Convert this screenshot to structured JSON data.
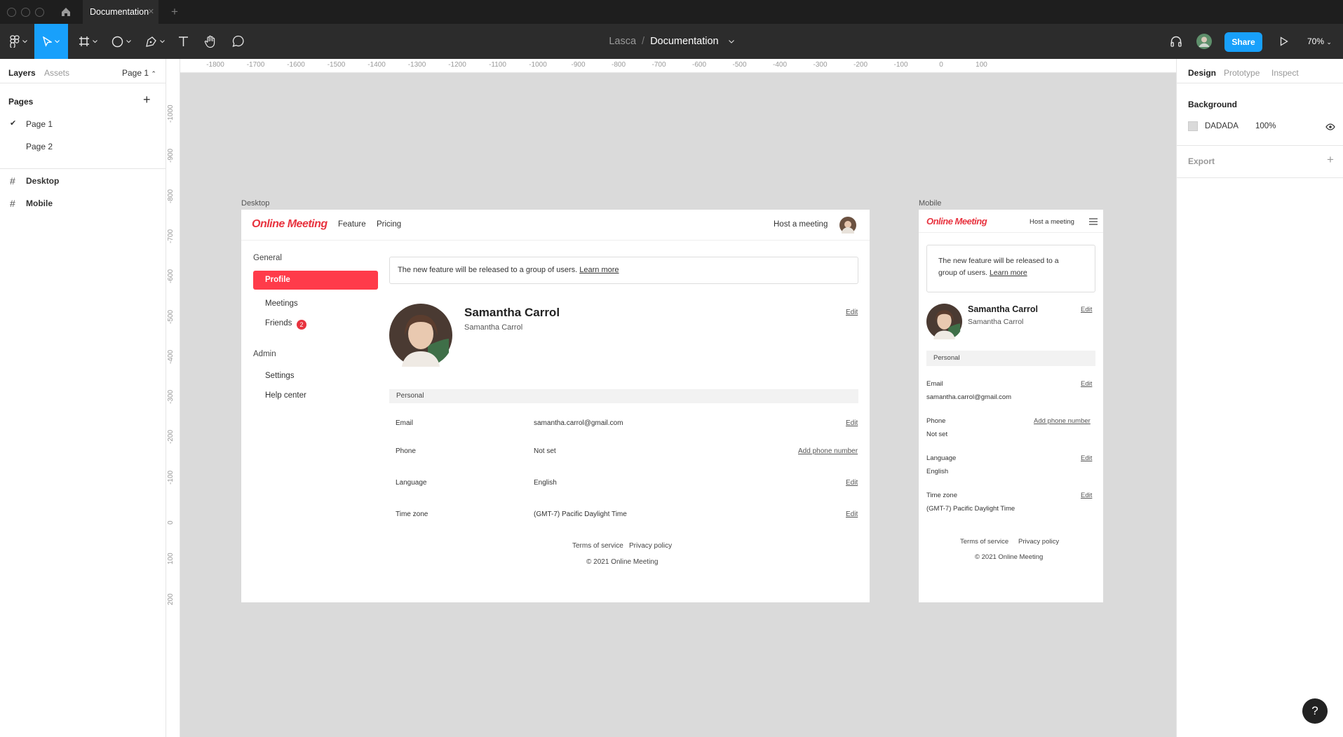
{
  "app": {
    "tab_title": "Documentation",
    "team": "Lasca",
    "separator": "/",
    "file": "Documentation",
    "share_label": "Share",
    "zoom": "70%"
  },
  "left_panel": {
    "tabs": [
      "Layers",
      "Assets"
    ],
    "page_selector": "Page 1",
    "pages_heading": "Pages",
    "pages": [
      "Page 1",
      "Page 2"
    ],
    "layers": [
      "Desktop",
      "Mobile"
    ]
  },
  "right_panel": {
    "tabs": [
      "Design",
      "Prototype",
      "Inspect"
    ],
    "background_heading": "Background",
    "bg_color": "DADADA",
    "bg_opacity": "100%",
    "export_heading": "Export"
  },
  "rulers": {
    "top": [
      "-1800",
      "-1700",
      "-1600",
      "-1500",
      "-1400",
      "-1300",
      "-1200",
      "-1100",
      "-1000",
      "-900",
      "-800",
      "-700",
      "-600",
      "-500",
      "-400",
      "-300",
      "-200",
      "-100",
      "0",
      "100"
    ],
    "left": [
      "-1000",
      "-900",
      "-800",
      "-700",
      "-600",
      "-500",
      "-400",
      "-300",
      "-200",
      "-100",
      "0",
      "100",
      "200"
    ]
  },
  "frames": {
    "desktop_label": "Desktop",
    "mobile_label": "Mobile"
  },
  "site": {
    "logo": "Online Meeting",
    "nav": [
      "Feature",
      "Pricing"
    ],
    "host": "Host a meeting",
    "sidebar": {
      "general": "General",
      "general_items": [
        "Profile",
        "Meetings",
        "Friends"
      ],
      "friends_badge": "2",
      "admin": "Admin",
      "admin_items": [
        "Settings",
        "Help center"
      ]
    },
    "banner_text": "The new feature will be released to a group of users.",
    "banner_text_mobile_1": "The new feature will be released to a",
    "banner_text_mobile_2": "group of users.",
    "banner_link": "Learn more",
    "name": "Samantha Carrol",
    "subname": "Samantha Carrol",
    "edit": "Edit",
    "section": "Personal",
    "fields": [
      {
        "label": "Email",
        "value": "samantha.carrol@gmail.com",
        "action": "Edit"
      },
      {
        "label": "Phone",
        "value": "Not set",
        "action": "Add phone number"
      },
      {
        "label": "Language",
        "value": "English",
        "action": "Edit"
      },
      {
        "label": "Time zone",
        "value": "(GMT-7) Pacific Daylight Time",
        "action": "Edit"
      }
    ],
    "footer_links": [
      "Terms of service",
      "Privacy policy"
    ],
    "copyright": "© 2021 Online Meeting"
  },
  "colors": {
    "accent": "#18a0fb",
    "brand": "#e8333f",
    "canvas": "#dadada"
  },
  "help": "?"
}
